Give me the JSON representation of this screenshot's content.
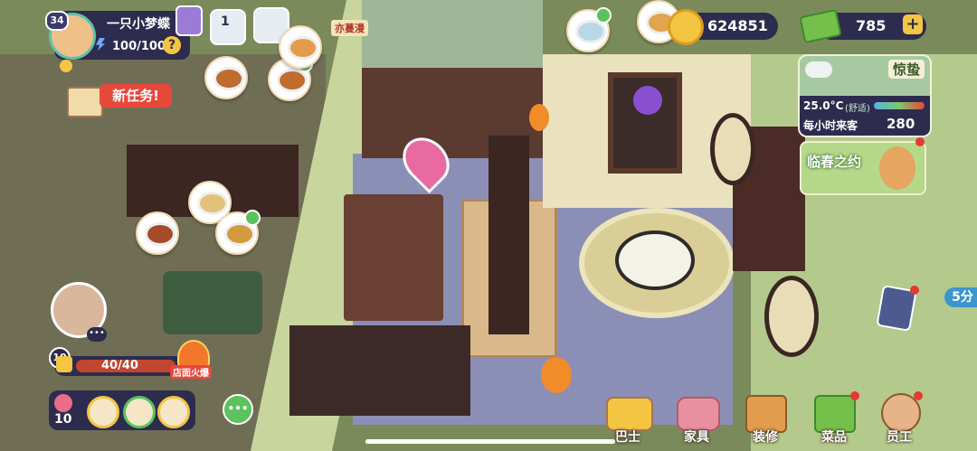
{
  "player": {
    "level": "34",
    "name": "一只小梦蝶",
    "energy": "100/100",
    "help_icon": "question-icon"
  },
  "top_icons": {
    "badge_count": "1"
  },
  "currency": {
    "coins": "624851",
    "cash": "785",
    "add_label": "+"
  },
  "signs": {
    "shop_name": "亦蔓漫"
  },
  "quest": {
    "new_task": "新任务!"
  },
  "weather": {
    "solar_term": "惊蛰",
    "temperature": "25.0°C",
    "comfort": "(舒适)",
    "visitors_label": "每小时来客",
    "visitors_value": "280"
  },
  "event": {
    "label": "临春之约"
  },
  "timer": {
    "label": "5分"
  },
  "left_panel": {
    "staff_level": "10",
    "progress": "40/40",
    "fire_label": "店面火爆",
    "flower_count": "10"
  },
  "bottom_nav": [
    {
      "label": "巴士",
      "icon": "bus-icon"
    },
    {
      "label": "家具",
      "icon": "sofa-icon"
    },
    {
      "label": "装修",
      "icon": "decoration-icon"
    },
    {
      "label": "菜品",
      "icon": "recipe-book-icon"
    },
    {
      "label": "员工",
      "icon": "staff-icon"
    }
  ],
  "colors": {
    "hud_dark": "#2d2c4f",
    "coin": "#f4c542",
    "cash": "#74c04a",
    "alert_red": "#e53935"
  }
}
